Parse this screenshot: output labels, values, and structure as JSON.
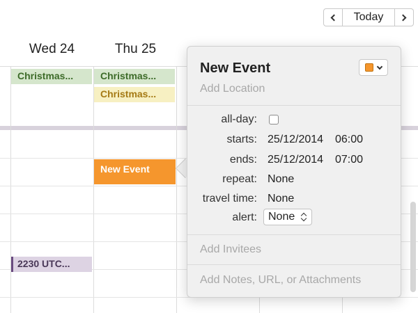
{
  "toolbar": {
    "today_label": "Today"
  },
  "days": [
    {
      "label": "Wed 24"
    },
    {
      "label": "Thu 25"
    }
  ],
  "events": {
    "wed_christmas": "Christmas...",
    "thu_christmas_1": "Christmas...",
    "thu_christmas_2": "Christmas...",
    "new_event": "New Event",
    "utc_event": "2230 UTC..."
  },
  "popover": {
    "title": "New Event",
    "location_placeholder": "Add Location",
    "fields": {
      "allday_label": "all-day:",
      "starts_label": "starts:",
      "starts_date": "25/12/2014",
      "starts_time": "06:00",
      "ends_label": "ends:",
      "ends_date": "25/12/2014",
      "ends_time": "07:00",
      "repeat_label": "repeat:",
      "repeat_value": "None",
      "travel_label": "travel time:",
      "travel_value": "None",
      "alert_label": "alert:",
      "alert_value": "None"
    },
    "add_invitees": "Add Invitees",
    "add_notes": "Add Notes, URL, or Attachments"
  },
  "colors": {
    "event_orange": "#f5962d",
    "event_green": "#d5e6cc",
    "event_yellow": "#f7f0c2",
    "event_purple": "#ddd3e3"
  },
  "icons": {
    "prev": "chevron-left-icon",
    "next": "chevron-right-icon",
    "calendar_color": "calendar-color-swatch",
    "dropdown": "chevron-down-icon",
    "stepper": "up-down-arrows-icon"
  }
}
